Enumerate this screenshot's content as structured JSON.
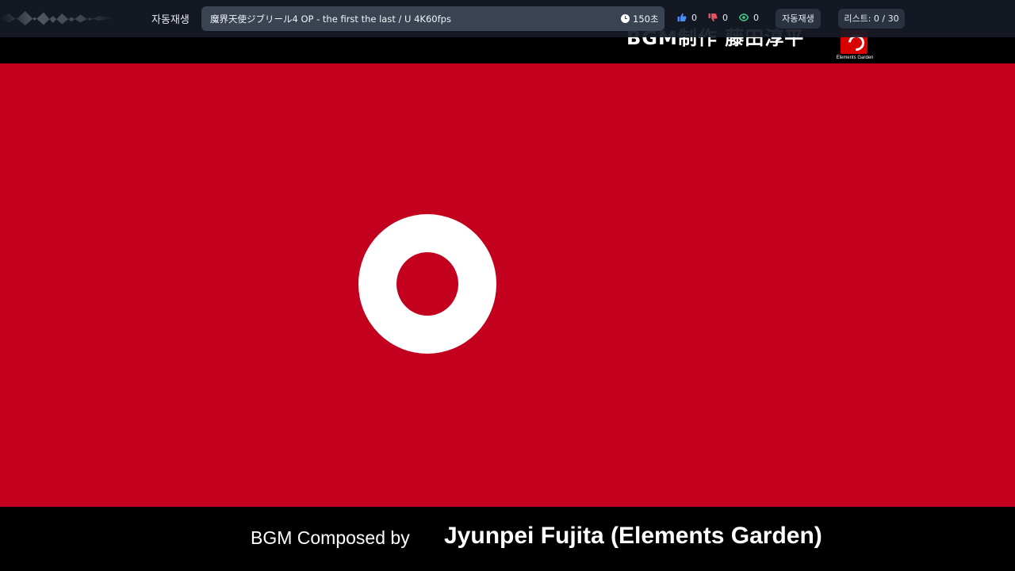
{
  "video": {
    "top_credit": "BGM制作 藤田淳平",
    "logo_text": "Elements Garden",
    "credit_prefix": "BGM Composed by",
    "credit_name": "Jyunpei Fujita (Elements Garden)",
    "colors": {
      "frame_red": "#c3011f",
      "ring_white": "#ffffff"
    }
  },
  "topbar": {
    "autoplay_label": "자동재생",
    "title": "魔界天使ジブリール4 OP - the first the last / U 4K60fps",
    "timer": "150초",
    "likes": "0",
    "dislikes": "0",
    "views": "0",
    "autoplay_button": "자동재생",
    "list_button": "리스트: 0 / 30",
    "icons": {
      "like": "thumbs-up-icon",
      "dislike": "thumbs-down-icon",
      "view": "eye-icon",
      "timer": "clock-icon"
    },
    "colors": {
      "like": "#4a8ff0",
      "dislike": "#e8505e",
      "view": "#3bd08a"
    }
  }
}
